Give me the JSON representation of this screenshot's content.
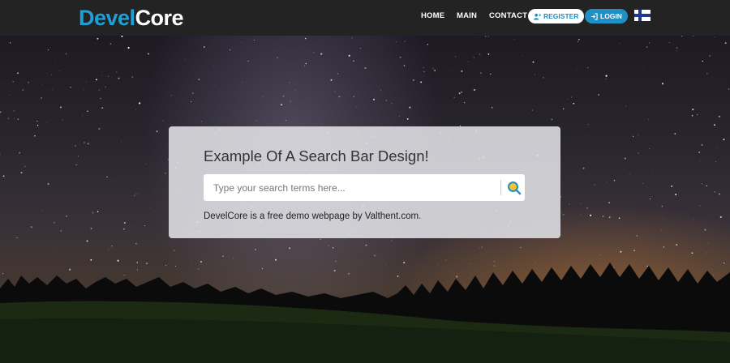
{
  "navbar": {
    "logo_part1": "Devel",
    "logo_part2": "Core",
    "links": [
      "HOME",
      "MAIN",
      "CONTACT"
    ],
    "register_label": "REGISTER",
    "login_label": "LOGIN",
    "language_flag": "finnish-flag-icon"
  },
  "search_card": {
    "title": "Example Of A Search Bar Design!",
    "placeholder": "Type your search terms here...",
    "search_icon": "search-icon",
    "note": "DevelCore is a free demo webpage by Valthent.com."
  },
  "colors": {
    "brand_blue": "#1ea0d6",
    "navbar_bg": "#232323",
    "login_bg": "#1e90c6"
  }
}
